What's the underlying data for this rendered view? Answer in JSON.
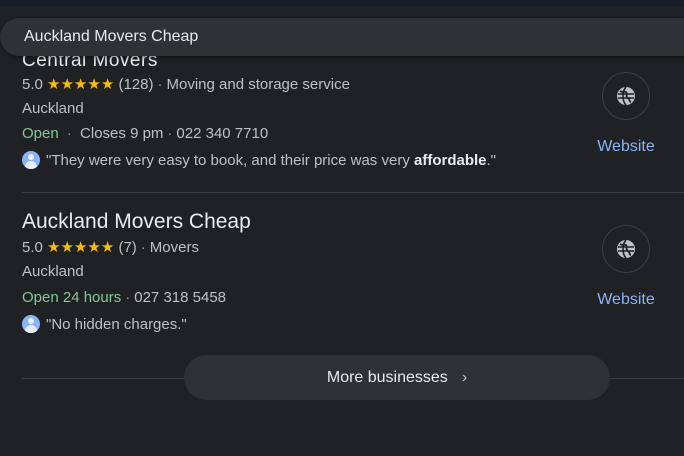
{
  "search": {
    "query": "Auckland Movers Cheap"
  },
  "listings": [
    {
      "name": "Central Movers",
      "rating": "5.0",
      "stars": "★★★★★",
      "review_count": "(128)",
      "category": "Moving and storage service",
      "location": "Auckland",
      "status": "Open",
      "hours": "Closes 9 pm",
      "phone": "022 340 7710",
      "review_pre": "\"They were very easy to book, and their price was very ",
      "review_bold": "affordable",
      "review_post": ".\"",
      "website_label": "Website"
    },
    {
      "name": "Auckland Movers Cheap",
      "rating": "5.0",
      "stars": "★★★★★",
      "review_count": "(7)",
      "category": "Movers",
      "location": "Auckland",
      "status": "Open 24 hours",
      "phone": "027 318 5458",
      "review": "\"No hidden charges.\"",
      "website_label": "Website"
    }
  ],
  "more_button": {
    "label": "More businesses",
    "chevron": "›"
  },
  "colors": {
    "background": "#202124",
    "link": "#8ab4f8",
    "open": "#81c995",
    "star": "#fbbc04"
  },
  "icons": [
    "globe-icon",
    "avatar-icon",
    "chevron-right-icon",
    "star-icon"
  ]
}
